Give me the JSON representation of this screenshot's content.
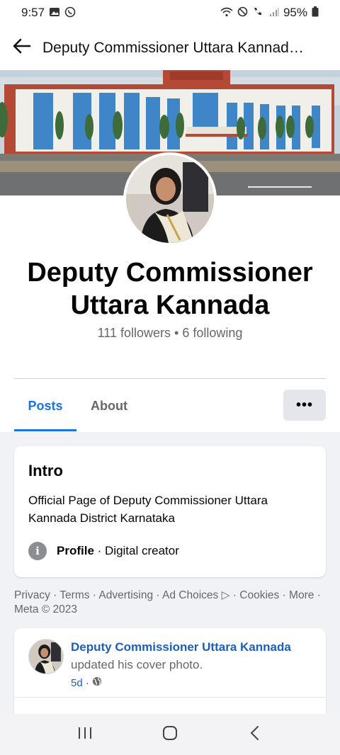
{
  "status_bar": {
    "time": "9:57",
    "battery": "95%",
    "left_icons": [
      "gallery-icon",
      "whatsapp-icon"
    ],
    "right_icons": [
      "wifi-icon",
      "do-not-disturb-icon",
      "wifi-call-icon",
      "signal-icon",
      "battery-icon"
    ]
  },
  "app_bar": {
    "title": "Deputy Commissioner Uttara Kannad…"
  },
  "profile": {
    "name": "Deputy Commissioner Uttara Kannada",
    "followers_line": "111 followers • 6 following"
  },
  "tabs": [
    {
      "label": "Posts",
      "active": true
    },
    {
      "label": "About",
      "active": false
    }
  ],
  "more_label": "•••",
  "intro": {
    "title": "Intro",
    "description": "Official Page of Deputy Commissioner Uttara Kannada District Karnataka",
    "profile_label": "Profile",
    "profile_value": "· Digital creator"
  },
  "footer": {
    "links": "Privacy · Terms · Advertising · Ad Choices ▷ · Cookies · More · Meta © 2023"
  },
  "post": {
    "author": "Deputy Commissioner Uttara Kannada",
    "action": "updated his cover photo.",
    "time": "5d ·"
  },
  "colors": {
    "accent": "#1b74e4",
    "feed_bg": "#f0f2f5",
    "muted_text": "#65676b"
  }
}
